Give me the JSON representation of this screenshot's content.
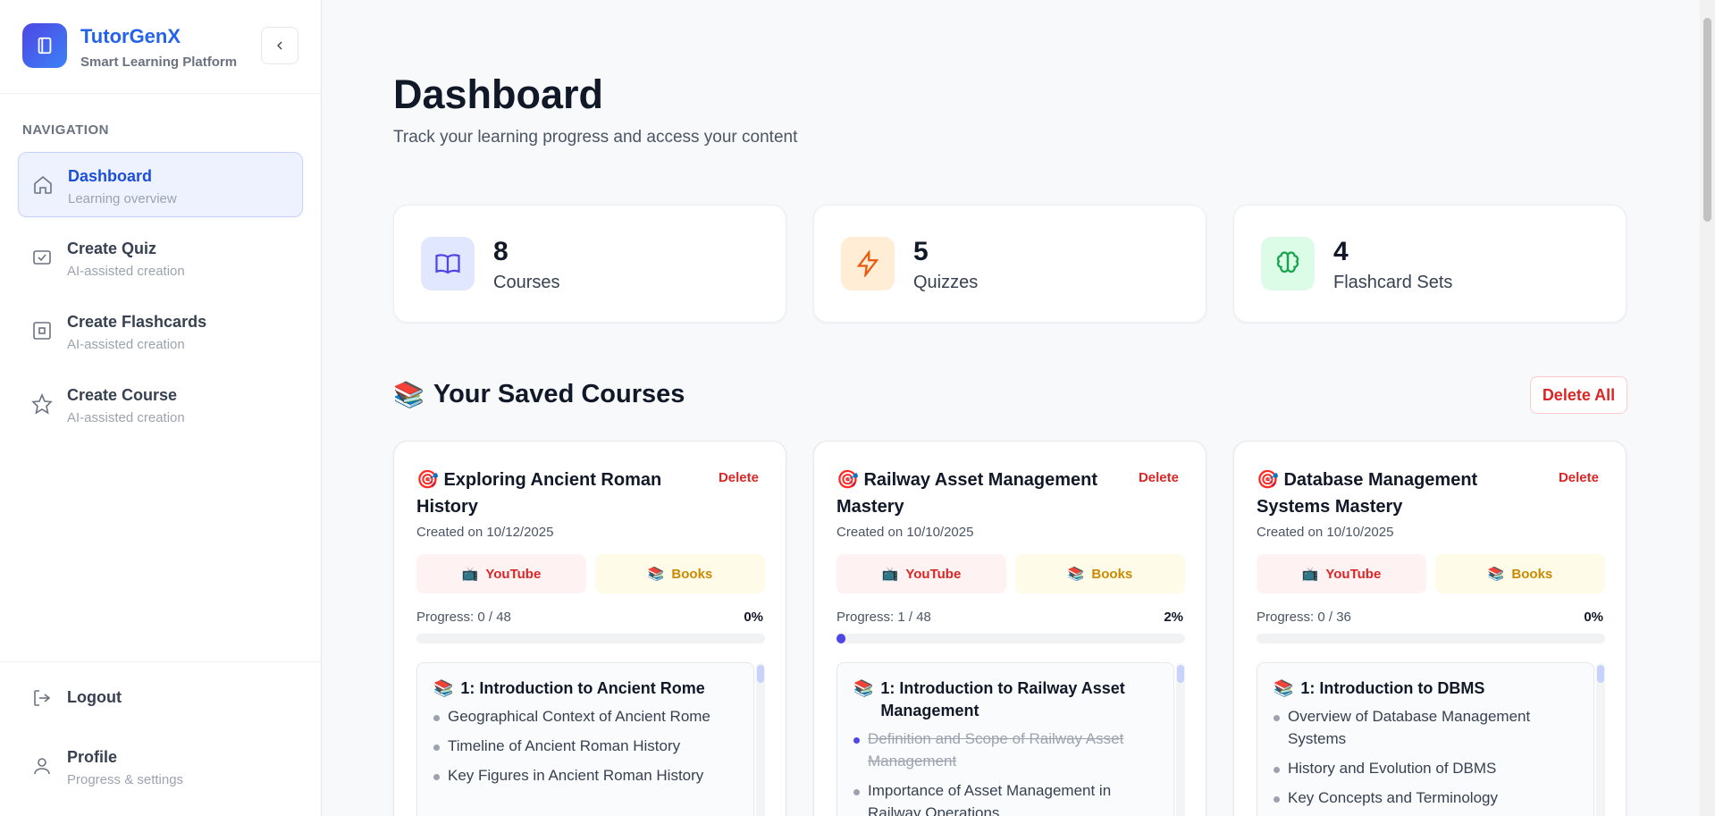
{
  "brand": {
    "title": "TutorGenX",
    "subtitle": "Smart Learning Platform"
  },
  "nav": {
    "heading": "NAVIGATION",
    "items": [
      {
        "label": "Dashboard",
        "desc": "Learning overview",
        "icon": "home-icon",
        "active": true
      },
      {
        "label": "Create Quiz",
        "desc": "AI-assisted creation",
        "icon": "checkbox-icon"
      },
      {
        "label": "Create Flashcards",
        "desc": "AI-assisted creation",
        "icon": "square-icon"
      },
      {
        "label": "Create Course",
        "desc": "AI-assisted creation",
        "icon": "star-icon"
      }
    ],
    "logout": "Logout",
    "profile": {
      "label": "Profile",
      "desc": "Progress & settings"
    }
  },
  "page": {
    "title": "Dashboard",
    "subtitle": "Track your learning progress and access your content"
  },
  "stats": [
    {
      "value": "8",
      "label": "Courses",
      "icon": "book-icon",
      "color": "#4f46e5"
    },
    {
      "value": "5",
      "label": "Quizzes",
      "icon": "lightning-icon",
      "color": "#ea580c"
    },
    {
      "value": "4",
      "label": "Flashcard Sets",
      "icon": "brain-icon",
      "color": "#16a34a"
    }
  ],
  "section": {
    "title": "Your Saved Courses",
    "delete_all": "Delete All"
  },
  "courses": [
    {
      "title": "Exploring Ancient Roman History",
      "delete": "Delete",
      "date": "Created on 10/12/2025",
      "youtube": "YouTube",
      "books": "Books",
      "progress_label": "Progress: 0 / 48",
      "progress_pct": "0%",
      "progress": 0,
      "module_title": "1: Introduction to Ancient Rome",
      "topics": [
        {
          "text": "Geographical Context of Ancient Rome",
          "done": false
        },
        {
          "text": "Timeline of Ancient Roman History",
          "done": false
        },
        {
          "text": "Key Figures in Ancient Roman History",
          "done": false
        }
      ]
    },
    {
      "title": "Railway Asset Management Mastery",
      "delete": "Delete",
      "date": "Created on 10/10/2025",
      "youtube": "YouTube",
      "books": "Books",
      "progress_label": "Progress: 1 / 48",
      "progress_pct": "2%",
      "progress": 0.02,
      "module_title": "1: Introduction to Railway Asset Management",
      "topics": [
        {
          "text": "Definition and Scope of Railway Asset Management",
          "done": true
        },
        {
          "text": "Importance of Asset Management in Railway Operations",
          "done": false
        }
      ]
    },
    {
      "title": "Database Management Systems Mastery",
      "delete": "Delete",
      "date": "Created on 10/10/2025",
      "youtube": "YouTube",
      "books": "Books",
      "progress_label": "Progress: 0 / 36",
      "progress_pct": "0%",
      "progress": 0,
      "module_title": "1: Introduction to DBMS",
      "topics": [
        {
          "text": "Overview of Database Management Systems",
          "done": false
        },
        {
          "text": "History and Evolution of DBMS",
          "done": false
        },
        {
          "text": "Key Concepts and Terminology",
          "done": false
        }
      ]
    }
  ]
}
